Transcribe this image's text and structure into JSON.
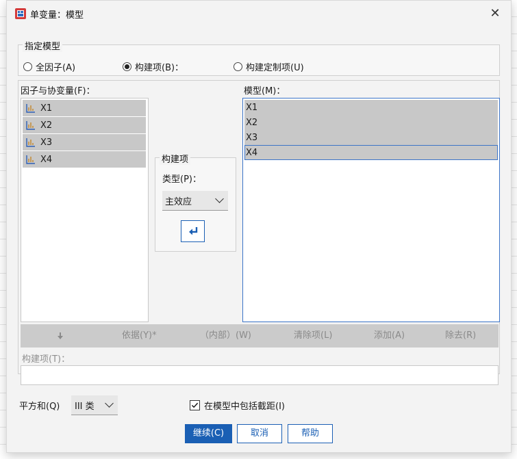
{
  "window": {
    "title": "单变量：模型",
    "close_glyph": "✕"
  },
  "specify_model": {
    "title": "指定模型",
    "options": [
      {
        "label": "全因子(A)",
        "checked": false
      },
      {
        "label": "构建项(B)：",
        "checked": true
      },
      {
        "label": "构建定制项(U)",
        "checked": false
      }
    ]
  },
  "factors": {
    "label": "因子与协变量(F)：",
    "items": [
      "X1",
      "X2",
      "X3",
      "X4"
    ],
    "item_icon": "scale-variable-icon"
  },
  "model": {
    "label": "模型(M)：",
    "items": [
      "X1",
      "X2",
      "X3",
      "X4"
    ],
    "selected": "X4"
  },
  "build_term": {
    "title": "构建项",
    "type_label": "类型(P)：",
    "type_value": "主效应",
    "move_icon": "arrow-enter-icon"
  },
  "toolbar": {
    "down_icon": "arrow-down-icon",
    "by_label": "依据(Y)*",
    "within_label": "（内部）(W)",
    "clear_label": "清除项(L)",
    "add_label": "添加(A)",
    "remove_label": "除去(R)"
  },
  "term_field": {
    "label": "构建项(T)：",
    "value": ""
  },
  "sum_of_squares": {
    "label": "平方和(Q)",
    "value": "III 类"
  },
  "include_intercept": {
    "label": "在模型中包括截距(I)",
    "checked": true
  },
  "buttons": {
    "continue": "继续(C)",
    "cancel": "取消",
    "help": "帮助"
  },
  "colors": {
    "accent": "#1a5fb4",
    "selection": "#c8c8c8",
    "focus_border": "#3b73c7"
  }
}
